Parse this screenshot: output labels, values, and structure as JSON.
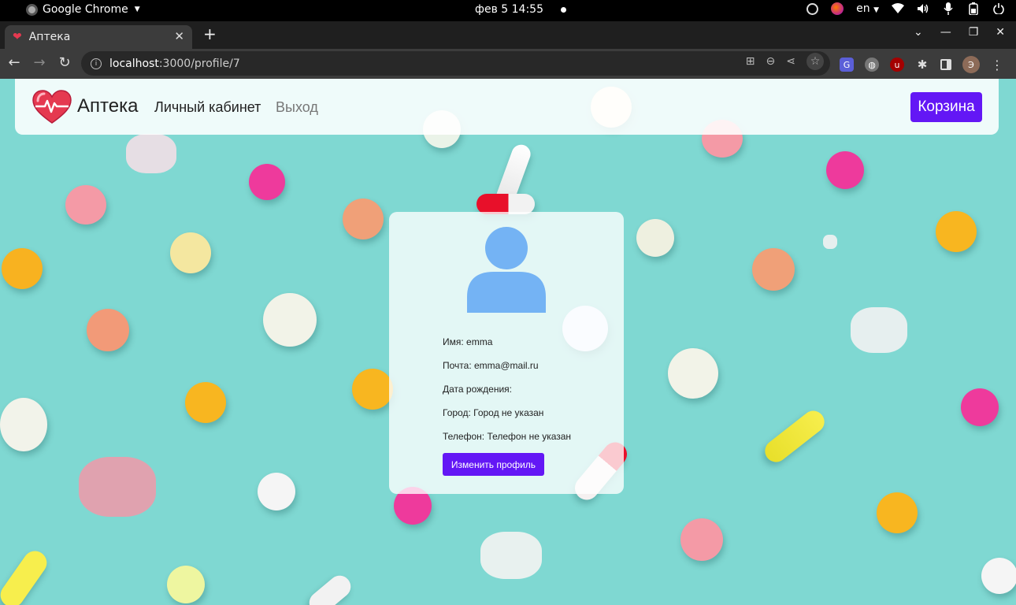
{
  "os": {
    "app_name": "Google Chrome",
    "clock": "фев 5  14:55",
    "language": "en"
  },
  "browser": {
    "tab_title": "Аптека",
    "url_host": "localhost",
    "url_path": ":3000/profile/7",
    "profile_initial": "Э"
  },
  "navbar": {
    "brand": "Аптека",
    "cabinet_link": "Личный кабинет",
    "logout_link": "Выход",
    "cart_button": "Корзина"
  },
  "profile": {
    "name_label": "Имя: ",
    "name_value": "emma",
    "email_label": "Почта: ",
    "email_value": "emma@mail.ru",
    "birthdate_label": "Дата рождения:",
    "city_label": "Город: ",
    "city_value": "Город не указан",
    "phone_label": "Телефон: ",
    "phone_value": "Телефон не указан",
    "edit_button": "Изменить профиль"
  },
  "colors": {
    "accent": "#6317f5",
    "background": "#7fd8d2",
    "avatar_icon": "#74b3f4",
    "logo_heart": "#e53950"
  }
}
